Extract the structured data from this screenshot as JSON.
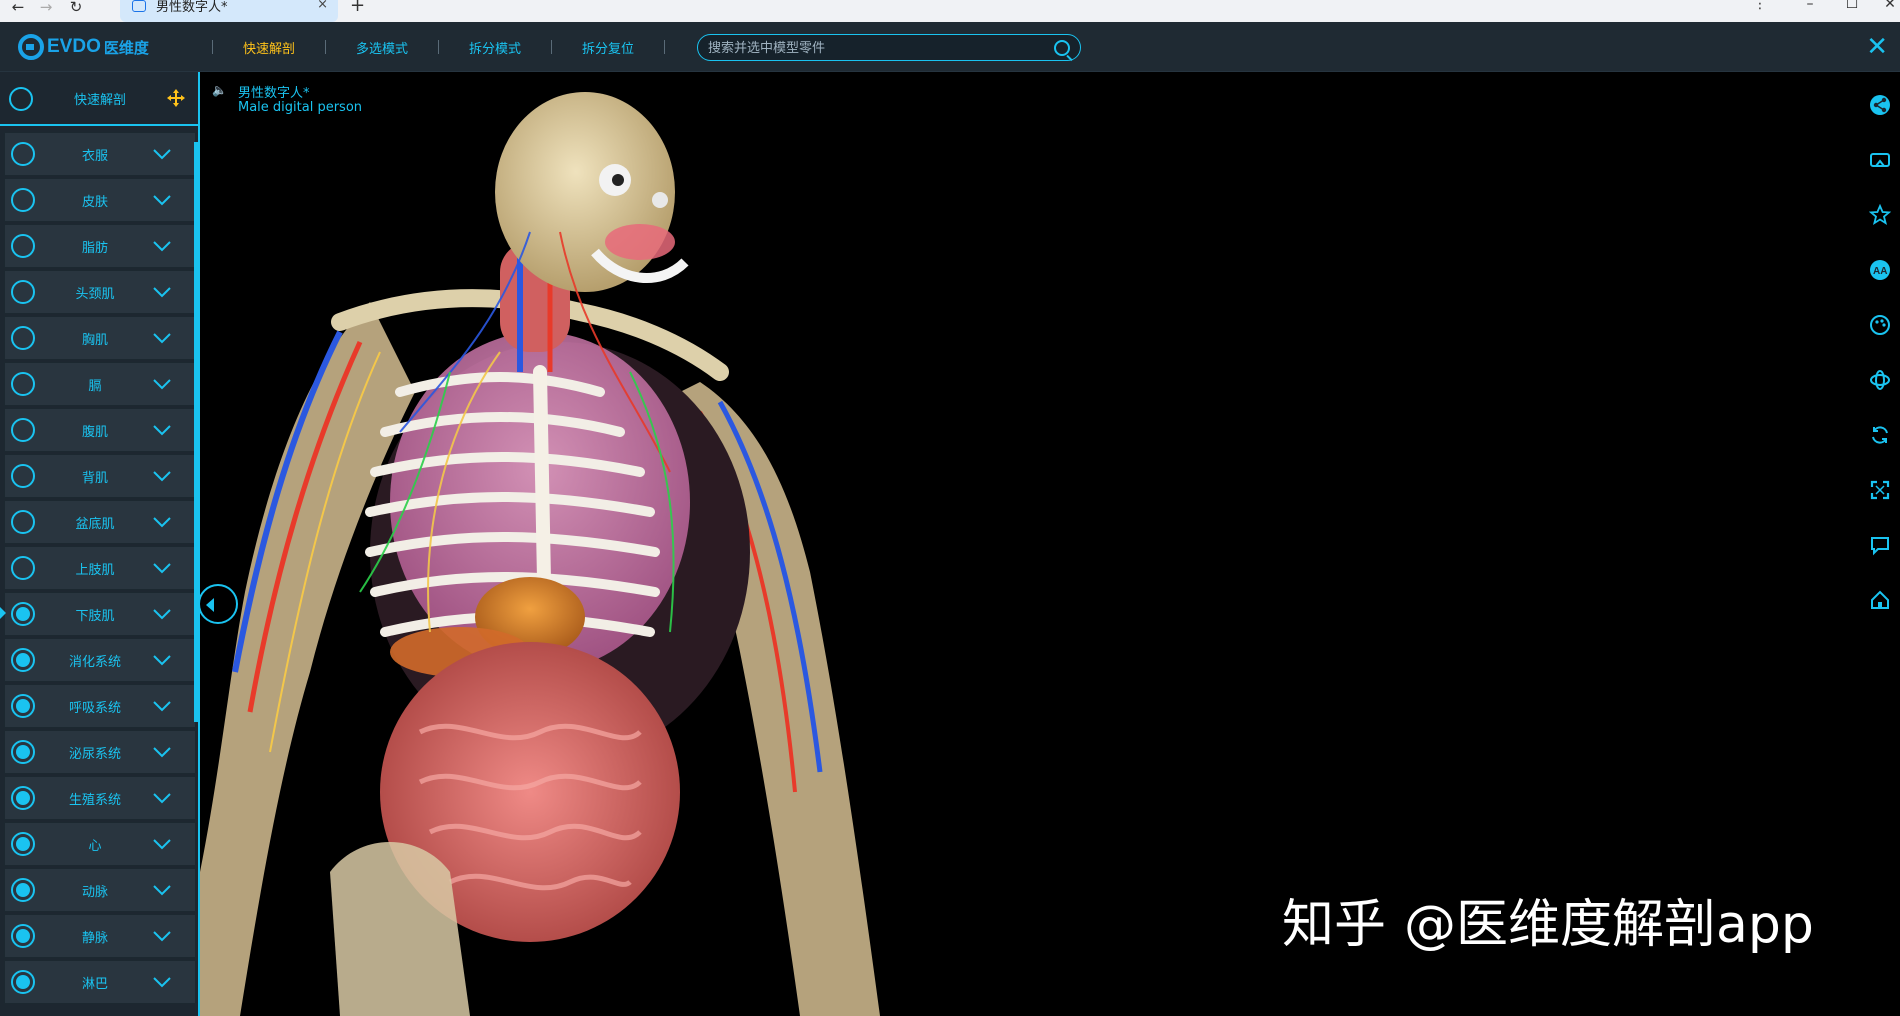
{
  "browser": {
    "tab_title": "男性数字人*",
    "new_tab": "+",
    "tab_close": "×"
  },
  "header": {
    "brand": "EVDO",
    "brand_cn": "医维度",
    "menu": [
      {
        "label": "快速解剖",
        "active": true
      },
      {
        "label": "多选模式",
        "active": false
      },
      {
        "label": "拆分模式",
        "active": false
      },
      {
        "label": "拆分复位",
        "active": false
      }
    ],
    "search_placeholder": "搜索并选中模型零件",
    "close": "✕"
  },
  "sidebar": {
    "header_label": "快速解剖",
    "items": [
      {
        "label": "衣服",
        "on": false
      },
      {
        "label": "皮肤",
        "on": false
      },
      {
        "label": "脂肪",
        "on": false
      },
      {
        "label": "头颈肌",
        "on": false
      },
      {
        "label": "胸肌",
        "on": false
      },
      {
        "label": "膈",
        "on": false
      },
      {
        "label": "腹肌",
        "on": false
      },
      {
        "label": "背肌",
        "on": false
      },
      {
        "label": "盆底肌",
        "on": false
      },
      {
        "label": "上肢肌",
        "on": false
      },
      {
        "label": "下肢肌",
        "on": true
      },
      {
        "label": "消化系统",
        "on": true
      },
      {
        "label": "呼吸系统",
        "on": true
      },
      {
        "label": "泌尿系统",
        "on": true
      },
      {
        "label": "生殖系统",
        "on": true
      },
      {
        "label": "心",
        "on": true
      },
      {
        "label": "动脉",
        "on": true
      },
      {
        "label": "静脉",
        "on": true
      },
      {
        "label": "淋巴",
        "on": true
      }
    ]
  },
  "viewport": {
    "model_title_cn": "男性数字人*",
    "model_title_en": "Male digital person"
  },
  "tools": [
    "share-icon",
    "vr-icon",
    "star-icon",
    "font-size-icon",
    "palette-icon",
    "rotate-axis-icon",
    "refresh-icon",
    "fullscreen-icon",
    "comment-icon",
    "home-icon"
  ],
  "watermark": {
    "zh": "知乎",
    "handle": "@医维度解剖app"
  },
  "colors": {
    "accent": "#1ac3f0",
    "active": "#ffc21a",
    "header_bg": "#1f2a33",
    "sidebar_row": "#29353f"
  }
}
